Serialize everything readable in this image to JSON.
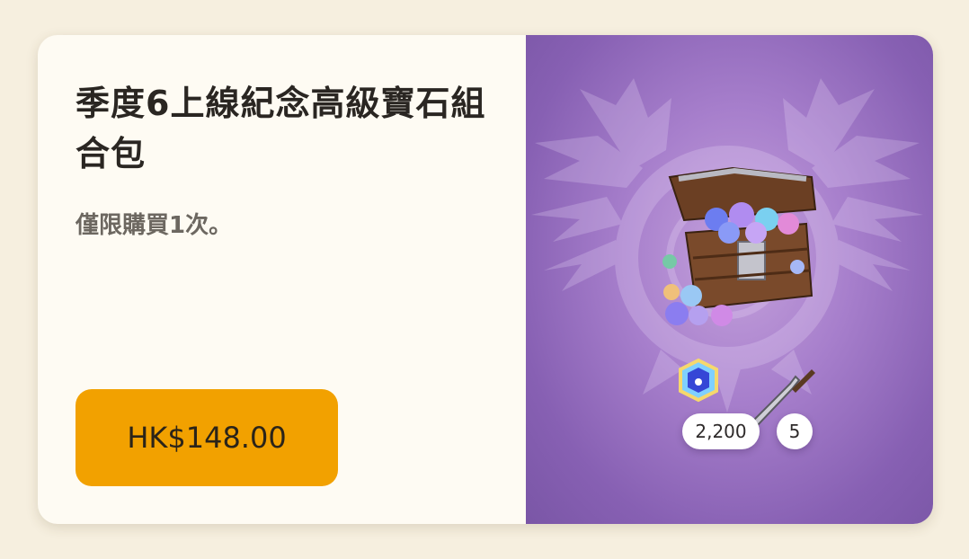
{
  "product": {
    "title": "季度6上線紀念高級寶石組合包",
    "limit_text": "僅限購買1次。",
    "price_label": "HK$148.00"
  },
  "rewards": [
    {
      "icon": "gem-badge-icon",
      "quantity": "2,200"
    },
    {
      "icon": "knife-icon",
      "quantity": "5"
    }
  ],
  "artwork": {
    "icon": "treasure-chest-icon",
    "emblem": "wyvern-emblem-icon"
  },
  "colors": {
    "page_background": "#f6efdf",
    "card_background": "#fefbf3",
    "price_button": "#f2a100",
    "artwork_background": "#a77fcc"
  }
}
